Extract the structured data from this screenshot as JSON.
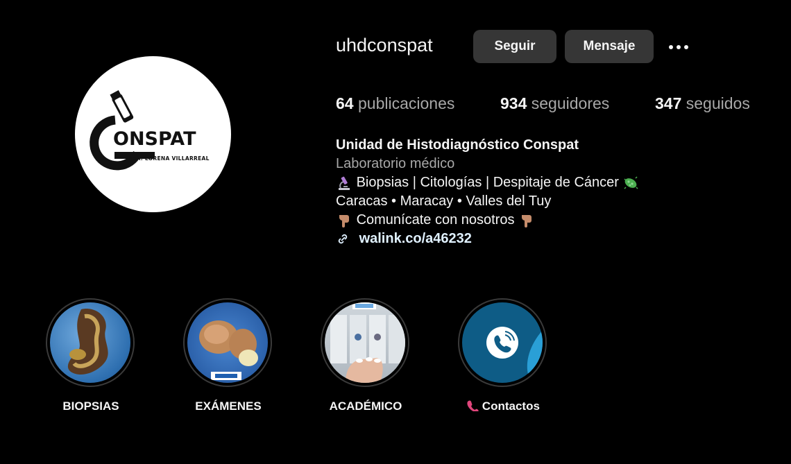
{
  "profile": {
    "username": "uhdconspat",
    "follow_label": "Seguir",
    "message_label": "Mensaje",
    "avatar": {
      "logo_word": "ONSPAT",
      "logo_sub": "DRA. LORENA VILLARREAL"
    }
  },
  "stats": {
    "posts_count": "64",
    "posts_label": "publicaciones",
    "followers_count": "934",
    "followers_label": "seguidores",
    "following_count": "347",
    "following_label": "seguidos"
  },
  "bio": {
    "name": "Unidad de Histodiagnóstico Conspat",
    "category": "Laboratorio médico",
    "line1": "Biopsias | Citologías | Despitaje de Cáncer",
    "line2": "Caracas • Maracay • Valles del Tuy",
    "line3": "Comunícate con nosotros",
    "link": "walink.co/a46232"
  },
  "highlights": [
    {
      "label": "BIOPSIAS"
    },
    {
      "label": "EXÁMENES"
    },
    {
      "label": "ACADÉMICO"
    },
    {
      "label": "Contactos"
    }
  ],
  "colors": {
    "background": "#000000",
    "button_bg": "#363636",
    "secondary_text": "#a8a8a8",
    "contact_teal": "#0e5c86"
  }
}
